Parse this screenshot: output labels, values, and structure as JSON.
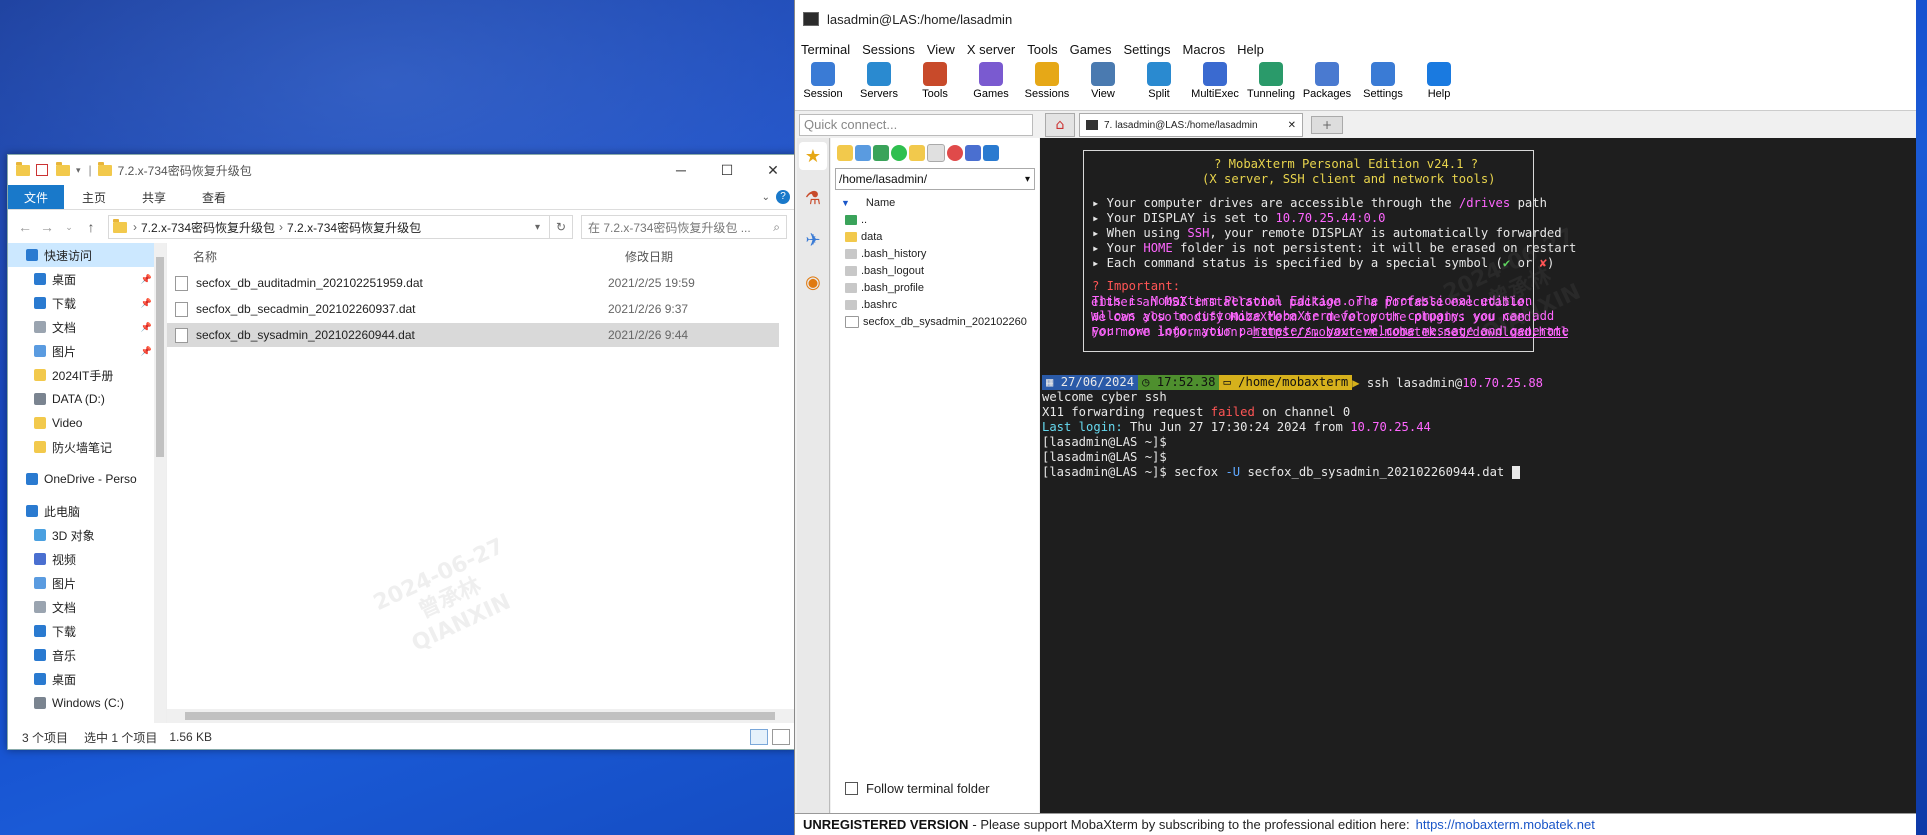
{
  "explorer": {
    "title": "7.2.x-734密码恢复升级包",
    "ribbon_tabs": [
      "文件",
      "主页",
      "共享",
      "查看"
    ],
    "breadcrumb": [
      "7.2.x-734密码恢复升级包",
      "7.2.x-734密码恢复升级包"
    ],
    "search_placeholder": "在 7.2.x-734密码恢复升级包 ...",
    "nav_items": [
      {
        "label": "快速访问",
        "icon": "star-icon",
        "pinned": false
      },
      {
        "label": "桌面",
        "icon": "desktop-icon",
        "pinned": true
      },
      {
        "label": "下载",
        "icon": "download-icon",
        "pinned": true
      },
      {
        "label": "文档",
        "icon": "document-icon",
        "pinned": true
      },
      {
        "label": "图片",
        "icon": "picture-icon",
        "pinned": true
      },
      {
        "label": "2024IT手册",
        "icon": "folder-icon",
        "pinned": false
      },
      {
        "label": "DATA (D:)",
        "icon": "drive-icon",
        "pinned": false
      },
      {
        "label": "Video",
        "icon": "folder-icon",
        "pinned": false
      },
      {
        "label": "防火墙笔记",
        "icon": "folder-icon",
        "pinned": false
      },
      {
        "label": "OneDrive - Perso",
        "icon": "onedrive-icon",
        "pinned": false
      },
      {
        "label": "此电脑",
        "icon": "pc-icon",
        "pinned": false
      },
      {
        "label": "3D 对象",
        "icon": "3d-icon",
        "pinned": false
      },
      {
        "label": "视频",
        "icon": "video-icon",
        "pinned": false
      },
      {
        "label": "图片",
        "icon": "picture-icon",
        "pinned": false
      },
      {
        "label": "文档",
        "icon": "document-icon",
        "pinned": false
      },
      {
        "label": "下载",
        "icon": "download-icon",
        "pinned": false
      },
      {
        "label": "音乐",
        "icon": "music-icon",
        "pinned": false
      },
      {
        "label": "桌面",
        "icon": "desktop-icon",
        "pinned": false
      },
      {
        "label": "Windows (C:)",
        "icon": "drive-icon",
        "pinned": false
      }
    ],
    "columns": {
      "name": "名称",
      "modified": "修改日期"
    },
    "files": [
      {
        "name": "secfox_db_auditadmin_202102251959.dat",
        "modified": "2021/2/25 19:59"
      },
      {
        "name": "secfox_db_secadmin_202102260937.dat",
        "modified": "2021/2/26 9:37"
      },
      {
        "name": "secfox_db_sysadmin_202102260944.dat",
        "modified": "2021/2/26 9:44"
      }
    ],
    "status": {
      "count": "3 个项目",
      "selected": "选中 1 个项目",
      "size": "1.56 KB"
    }
  },
  "moba": {
    "title": "lasadmin@LAS:/home/lasadmin",
    "menu": [
      "Terminal",
      "Sessions",
      "View",
      "X server",
      "Tools",
      "Games",
      "Settings",
      "Macros",
      "Help"
    ],
    "toolbar": [
      "Session",
      "Servers",
      "Tools",
      "Games",
      "Sessions",
      "View",
      "Split",
      "MultiExec",
      "Tunneling",
      "Packages",
      "Settings",
      "Help"
    ],
    "quick_connect": "Quick connect...",
    "tab_label": "7. lasadmin@LAS:/home/lasadmin",
    "sftp_path": "/home/lasadmin/",
    "sftp_header": "Name",
    "sftp_items": [
      "..",
      "data",
      ".bash_history",
      ".bash_logout",
      ".bash_profile",
      ".bashrc",
      "secfox_db_sysadmin_202102260"
    ],
    "follow_label": "Follow terminal folder",
    "banner": {
      "title": "? MobaXterm Personal Edition v24.1 ?",
      "subtitle": "(X server, SSH client and network tools)",
      "b1a": "▸ Your computer drives are accessible through the ",
      "b1b": "/drives",
      "b1c": " path",
      "b2a": "▸ Your DISPLAY is set to ",
      "b2b": "10.70.25.44:0.0",
      "b3a": "▸ When using ",
      "b3b": "SSH",
      "b3c": ", your remote DISPLAY is automatically forwarded",
      "b4a": "▸ Your ",
      "b4b": "HOME",
      "b4c": " folder is not persistent: it will be erased on restart",
      "b5a": "▸ Each command status is specified by a special symbol (",
      "b5b": "✔",
      "b5c": " or ",
      "b5d": "✘",
      "b5e": ")",
      "imp": "? Important:",
      "p1": "This is MobaXterm Personal Edition. The Professional edition",
      "p2": "allows you to customize MobaXterm for your company: you can add",
      "p3": "your own logo, your parameters, your welcome message and generate",
      "p4": "either an MSI installation package or a portable executable.",
      "p5": "We can also modify MobaXterm or develop the plugins you need.",
      "p6a": "For more information: ",
      "p6b": "https://mobaxterm.mobatek.net/download.html"
    },
    "prompt": {
      "date": "27/06/2024",
      "time": "17:52.38",
      "path": "/home/mobaxterm",
      "cmd": " ssh lasadmin@",
      "host": "10.70.25.88"
    },
    "lines": {
      "welcome": "welcome cyber ssh",
      "x11a": "X11 forwarding request ",
      "x11b": "failed",
      "x11c": " on channel 0",
      "lla": "Last login:",
      "llb": " Thu Jun 27 17:30:24 2024 from ",
      "llc": "10.70.25.44",
      "p1": "[lasadmin@LAS ~]$",
      "p2": "[lasadmin@LAS ~]$",
      "p3a": "[lasadmin@LAS ~]$ secfox ",
      "p3b": "-U",
      "p3c": " secfox_db_sysadmin_202102260944.dat "
    },
    "unregistered": {
      "bold": "UNREGISTERED VERSION",
      "text": " -  Please support MobaXterm by subscribing to the professional edition here:",
      "link": "https://mobaxterm.mobatek.net"
    }
  },
  "watermark": {
    "date": "2024-06-27",
    "name": "曾承林",
    "org": "QIANXIN"
  }
}
